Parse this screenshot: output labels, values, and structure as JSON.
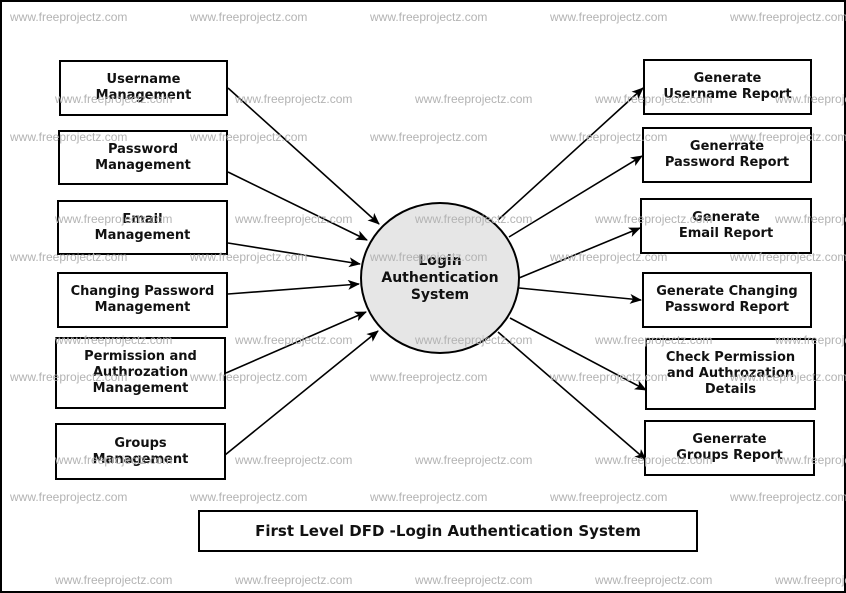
{
  "diagram": {
    "title": "First Level DFD -Login Authentication System",
    "central_process": "Login\nAuthentication\nSystem",
    "inputs": [
      "Username\nManagement",
      "Password\nManagement",
      "Email\nManagement",
      "Changing Password\nManagement",
      "Permission and\nAuthrozation\nManagement",
      "Groups\nManagement"
    ],
    "outputs": [
      "Generate\nUsername Report",
      "Generrate\nPassword Report",
      "Generate\nEmail Report",
      "Generate Changing\nPassword Report",
      "Check Permission\nand Authrozation\nDetails",
      "Generrate\nGroups Report"
    ],
    "watermark": "www.freeprojectz.com",
    "colors": {
      "process_fill": "#e6e6e6",
      "stroke": "#000000",
      "watermark": "#b3b3b3"
    }
  }
}
